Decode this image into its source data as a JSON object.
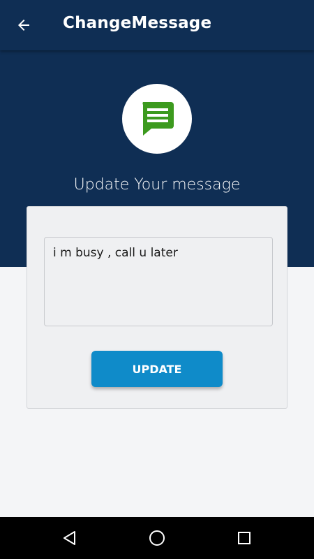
{
  "app_bar": {
    "title": "ChangeMessage",
    "back_icon": "arrow-left-icon"
  },
  "hero": {
    "icon": "message-bubble-icon",
    "icon_color": "#3c9a1e",
    "headline": "Update Your message"
  },
  "form": {
    "message_value": "i m busy , call u later",
    "update_label": "UPDATE"
  },
  "nav": {
    "back": "triangle-back-icon",
    "home": "circle-home-icon",
    "recents": "square-recents-icon"
  },
  "colors": {
    "primary": "#0f2e54",
    "accent": "#0f8bc9",
    "background": "#f4f5f7"
  }
}
